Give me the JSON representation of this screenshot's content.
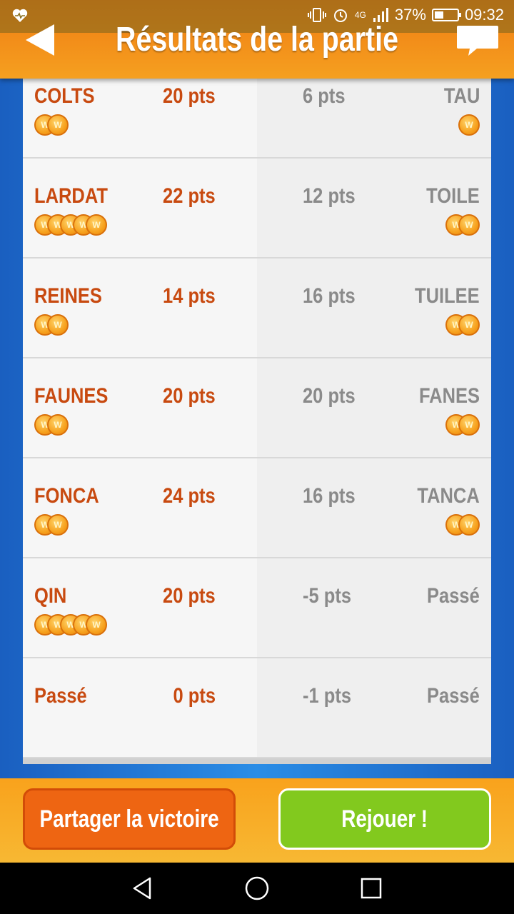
{
  "statusbar": {
    "network": "4G",
    "battery": "37%",
    "time": "09:32"
  },
  "header": {
    "title": "Résultats de la partie"
  },
  "rounds": [
    {
      "player_word": "COLTS",
      "player_points": "20 pts",
      "player_coins": 2,
      "opponent_points": "6 pts",
      "opponent_word": "TAU",
      "opponent_coins": 1
    },
    {
      "player_word": "LARDAT",
      "player_points": "22 pts",
      "player_coins": 5,
      "opponent_points": "12 pts",
      "opponent_word": "TOILE",
      "opponent_coins": 2
    },
    {
      "player_word": "REINES",
      "player_points": "14 pts",
      "player_coins": 2,
      "opponent_points": "16 pts",
      "opponent_word": "TUILEE",
      "opponent_coins": 2
    },
    {
      "player_word": "FAUNES",
      "player_points": "20 pts",
      "player_coins": 2,
      "opponent_points": "20 pts",
      "opponent_word": "FANES",
      "opponent_coins": 2
    },
    {
      "player_word": "FONCA",
      "player_points": "24 pts",
      "player_coins": 2,
      "opponent_points": "16 pts",
      "opponent_word": "TANCA",
      "opponent_coins": 2
    },
    {
      "player_word": "QIN",
      "player_points": "20 pts",
      "player_coins": 5,
      "opponent_points": "-5 pts",
      "opponent_word": "Passé",
      "opponent_coins": 0
    },
    {
      "player_word": "Passé",
      "player_points": "0 pts",
      "player_coins": 0,
      "opponent_points": "-1 pts",
      "opponent_word": "Passé",
      "opponent_coins": 0
    }
  ],
  "coin_letter": "W",
  "footer": {
    "share_label": "Partager la victoire",
    "replay_label": "Rejouer !"
  },
  "colors": {
    "header_orange": "#f07b12",
    "player_text": "#c84a10",
    "opponent_text": "#8a8a8a",
    "share_button": "#ee6512",
    "replay_button": "#82c91e",
    "coin": "#f7a21e"
  }
}
